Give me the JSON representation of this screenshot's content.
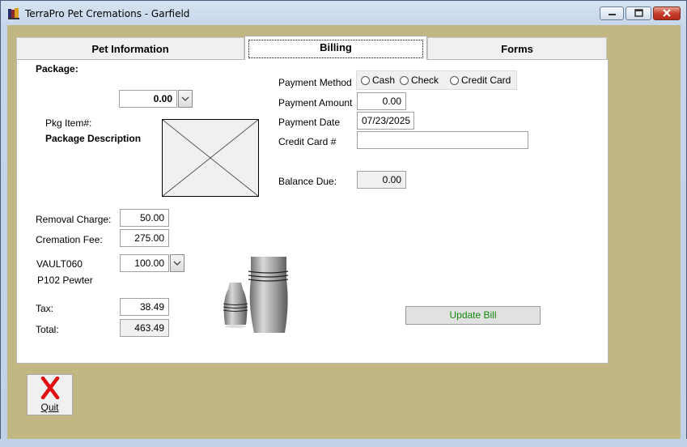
{
  "window": {
    "title": "TerraPro Pet Cremations - Garfield"
  },
  "tabs": [
    {
      "label": "Pet Information",
      "active": false
    },
    {
      "label": "Billing",
      "active": true
    },
    {
      "label": "Forms",
      "active": false
    }
  ],
  "package": {
    "label": "Package:",
    "value": "0.00",
    "pkg_item_label": "Pkg Item#:",
    "description_label": "Package Description"
  },
  "charges": {
    "removal_label": "Removal Charge:",
    "removal_value": "50.00",
    "cremation_label": "Cremation Fee:",
    "cremation_value": "275.00",
    "vault_code": "VAULT060",
    "vault_value": "100.00",
    "vault_name": "P102 Pewter",
    "tax_label": "Tax:",
    "tax_value": "38.49",
    "total_label": "Total:",
    "total_value": "463.49"
  },
  "payment": {
    "method_label": "Payment Method",
    "methods": [
      "Cash",
      "Check",
      "Credit Card"
    ],
    "amount_label": "Payment Amount",
    "amount_value": "0.00",
    "date_label": "Payment Date",
    "date_value": "07/23/2025",
    "card_label": "Credit Card #",
    "card_value": "",
    "balance_label": "Balance Due:",
    "balance_value": "0.00"
  },
  "buttons": {
    "update_bill": "Update Bill",
    "quit": "Quit"
  },
  "colors": {
    "client_bg": "#c2b682",
    "update_text": "#138a0c",
    "quit_icon": "#e01010"
  },
  "icons": [
    "app-icon",
    "minimize-icon",
    "maximize-icon",
    "close-icon",
    "chevron-down-icon",
    "quit-x-icon",
    "urn-image",
    "placeholder-image"
  ]
}
